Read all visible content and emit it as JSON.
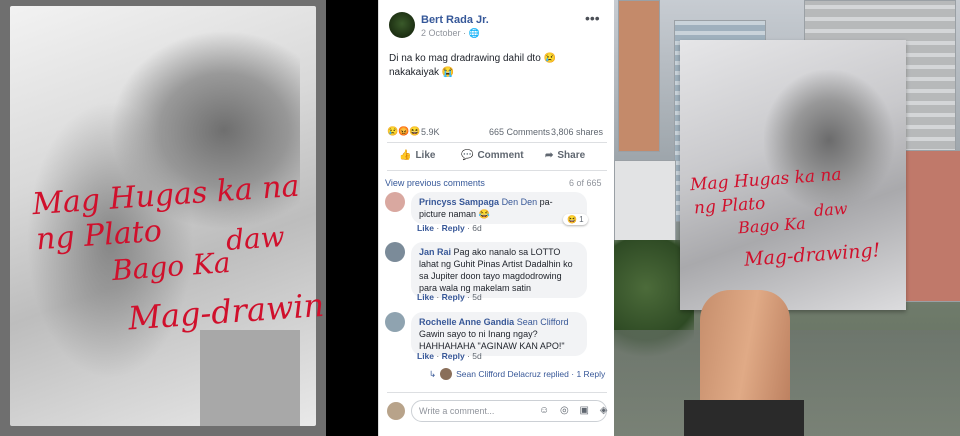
{
  "left_photo": {
    "handwriting": {
      "line1": "Mag Hugas ka na",
      "line2": "ng Plato",
      "line3": "Bago Ka",
      "line4": "Mag-drawing",
      "line5": "daw"
    }
  },
  "post": {
    "author": "Bert Rada Jr.",
    "date": "2 October · ",
    "date_icon": "globe-icon",
    "text": "Di na ko mag dradrawing dahil dto 😢 nakakaiyak 😭",
    "reactions_icons": "😢😡😆",
    "reactions_count": "5.9K",
    "comments_count": "665 Comments",
    "shares_count": "3,806 shares",
    "actions": {
      "like": "Like",
      "comment": "Comment",
      "share": "Share"
    },
    "view_previous": "View previous comments",
    "comment_ratio": "6 of 665",
    "comments": [
      {
        "name": "Princyss Sampaga",
        "tag": "Den Den",
        "text": " pa-picture naman 😂",
        "like": "Like",
        "reply": "Reply",
        "time": "6d",
        "badge": "😆 1"
      },
      {
        "name": "Jan Rai",
        "tag": "",
        "text": " Pag ako nanalo sa LOTTO lahat ng Guhit Pinas Artist Dadalhin ko sa Jupiter doon tayo magdodrowing para wala ng makelam satin",
        "like": "Like",
        "reply": "Reply",
        "time": "5d"
      },
      {
        "name": "Rochelle Anne Gandia",
        "tag": "Sean Clifford",
        "text": "Gawin sayo to ni Inang ngay? HAHHAHAHA \"AGINAW KAN APO!\"",
        "like": "Like",
        "reply": "Reply",
        "time": "5d"
      }
    ],
    "reply_line": "Sean Clifford Delacruz replied · 1 Reply",
    "write_placeholder": "Write a comment...",
    "write_icons": "☺ ◎ ▣ ◈"
  },
  "right_photo": {
    "handwriting": {
      "line1": "Mag Hugas ka na",
      "line2": "ng Plato",
      "line3": "Bago Ka",
      "line4": "Mag-drawing!",
      "line5": "daw"
    }
  },
  "colors": {
    "fb_link": "#365899",
    "handwriting_red": "#d0102c"
  }
}
